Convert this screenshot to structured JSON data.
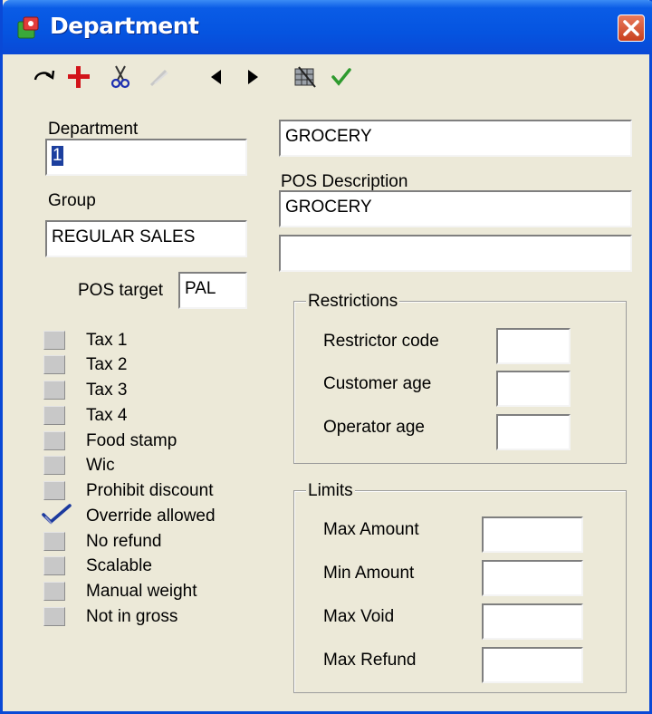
{
  "window": {
    "title": "Department"
  },
  "toolbar": {
    "buttons": [
      {
        "name": "refresh-icon",
        "symbol": "↻"
      },
      {
        "name": "add-icon",
        "symbol": "+"
      },
      {
        "name": "cut-icon",
        "symbol": "✂"
      },
      {
        "name": "edit-icon-disabled",
        "symbol": "✎"
      },
      {
        "name": "previous-icon",
        "symbol": "◀"
      },
      {
        "name": "next-icon",
        "symbol": "▶"
      },
      {
        "name": "grid-icon",
        "symbol": "▦"
      },
      {
        "name": "check-icon",
        "symbol": "✔"
      }
    ]
  },
  "form": {
    "department_label": "Department",
    "department_value": "1",
    "name_value": "GROCERY",
    "group_label": "Group",
    "group_value": "REGULAR SALES",
    "pos_description_label": "POS Description",
    "pos_description_value": "GROCERY",
    "pos_description_value2": "",
    "pos_target_label": "POS target",
    "pos_target_value": "PAL"
  },
  "checkboxes": [
    {
      "label": "Tax 1",
      "checked": false
    },
    {
      "label": "Tax 2",
      "checked": false
    },
    {
      "label": "Tax 3",
      "checked": false
    },
    {
      "label": "Tax 4",
      "checked": false
    },
    {
      "label": "Food stamp",
      "checked": false
    },
    {
      "label": "Wic",
      "checked": false
    },
    {
      "label": "Prohibit discount",
      "checked": false
    },
    {
      "label": "Override allowed",
      "checked": true
    },
    {
      "label": "No refund",
      "checked": false
    },
    {
      "label": "Scalable",
      "checked": false
    },
    {
      "label": "Manual weight",
      "checked": false
    },
    {
      "label": "Not in gross",
      "checked": false
    }
  ],
  "restrictions": {
    "title": "Restrictions",
    "restrictor_code_label": "Restrictor code",
    "restrictor_code_value": "",
    "customer_age_label": "Customer age",
    "customer_age_value": "",
    "operator_age_label": "Operator age",
    "operator_age_value": ""
  },
  "limits": {
    "title": "Limits",
    "max_amount_label": "Max Amount",
    "max_amount_value": "",
    "min_amount_label": "Min Amount",
    "min_amount_value": "",
    "max_void_label": "Max Void",
    "max_void_value": "",
    "max_refund_label": "Max Refund",
    "max_refund_value": ""
  },
  "colors": {
    "titlebar": "#0a5ce6",
    "face": "#ece9d8",
    "check": "#1c3a9e"
  }
}
